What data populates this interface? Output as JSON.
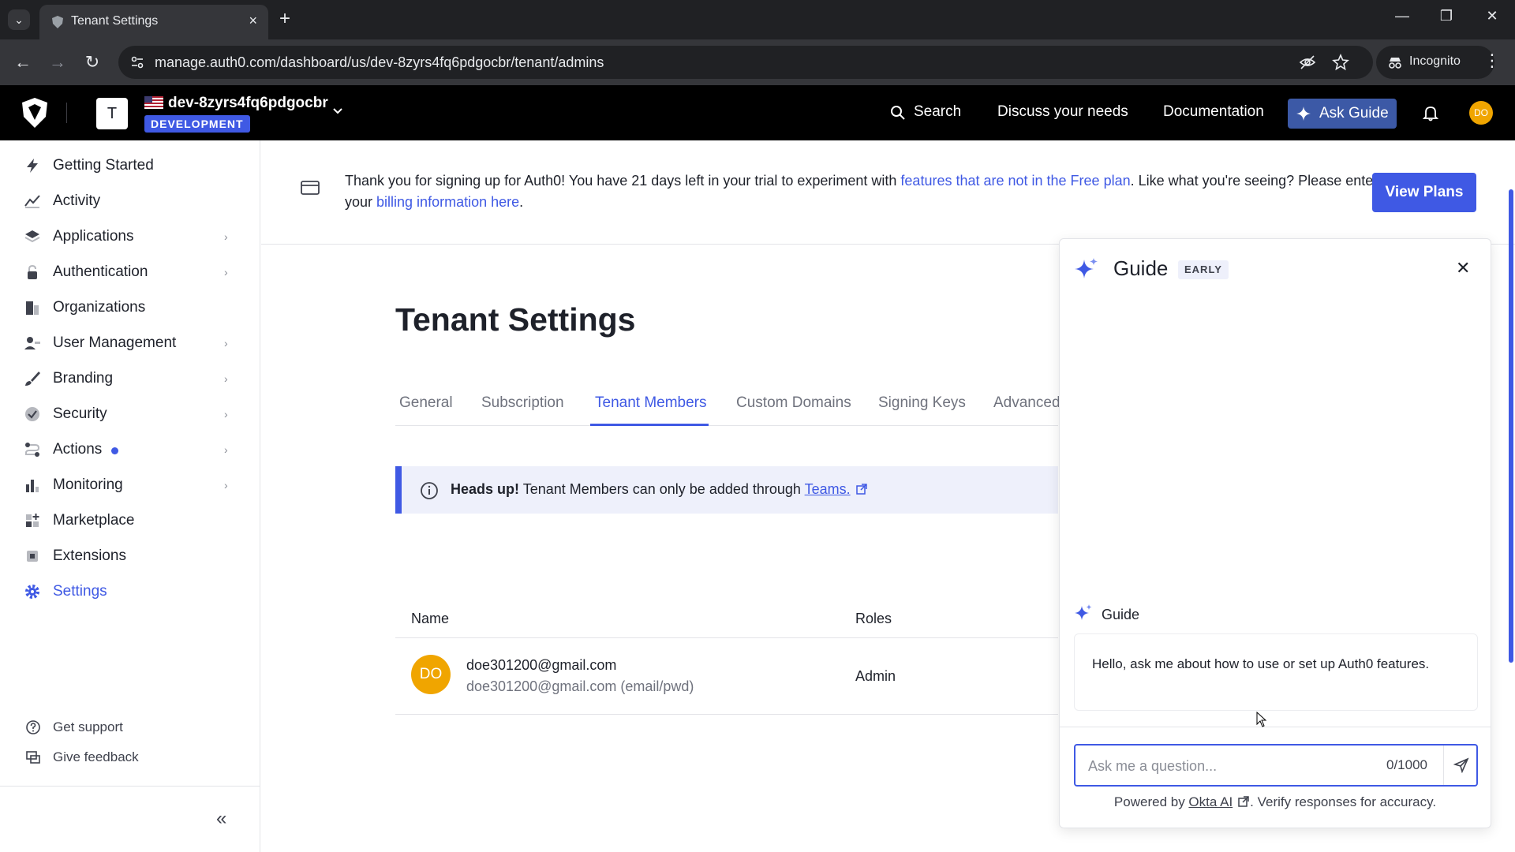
{
  "browser": {
    "tab_title": "Tenant Settings",
    "url": "manage.auth0.com/dashboard/us/dev-8zyrs4fq6pdgocbr/tenant/admins",
    "incognito_label": "Incognito"
  },
  "header": {
    "tenant_initial": "T",
    "tenant_name": "dev-8zyrs4fq6pdgocbr",
    "env_badge": "DEVELOPMENT",
    "search_label": "Search",
    "discuss_label": "Discuss your needs",
    "docs_label": "Documentation",
    "ask_guide_label": "Ask Guide",
    "user_initials": "DO"
  },
  "sidebar": {
    "items": [
      {
        "label": "Getting Started",
        "icon": "bolt-icon"
      },
      {
        "label": "Activity",
        "icon": "activity-icon"
      },
      {
        "label": "Applications",
        "icon": "layers-icon"
      },
      {
        "label": "Authentication",
        "icon": "lock-icon"
      },
      {
        "label": "Organizations",
        "icon": "building-icon"
      },
      {
        "label": "User Management",
        "icon": "users-icon"
      },
      {
        "label": "Branding",
        "icon": "brush-icon"
      },
      {
        "label": "Security",
        "icon": "shield-check-icon"
      },
      {
        "label": "Actions",
        "icon": "flow-icon"
      },
      {
        "label": "Monitoring",
        "icon": "bar-chart-icon"
      },
      {
        "label": "Marketplace",
        "icon": "grid-plus-icon"
      },
      {
        "label": "Extensions",
        "icon": "extension-icon"
      },
      {
        "label": "Settings",
        "icon": "gear-icon"
      }
    ],
    "get_support": "Get support",
    "give_feedback": "Give feedback"
  },
  "banner": {
    "text_before": "Thank you for signing up for Auth0! You have 21 days left in your trial to experiment with ",
    "link_features": "features that are not in the Free plan",
    "text_middle": ". Like what you're seeing? Please enter your ",
    "link_billing": "billing information here",
    "text_end": ".",
    "view_plans_label": "View Plans"
  },
  "main": {
    "title": "Tenant Settings",
    "tabs": [
      "General",
      "Subscription",
      "Tenant Members",
      "Custom Domains",
      "Signing Keys",
      "Advanced"
    ],
    "alert": {
      "heading": "Heads up!",
      "text": " Tenant Members can only be added through ",
      "link": "Teams."
    },
    "table": {
      "headers": [
        "Name",
        "Roles"
      ],
      "rows": [
        {
          "initials": "DO",
          "email": "doe301200@gmail.com",
          "sub": "doe301200@gmail.com (email/pwd)",
          "role": "Admin"
        }
      ]
    }
  },
  "guide": {
    "title": "Guide",
    "badge": "EARLY",
    "message_author": "Guide",
    "message_text": "Hello, ask me about how to use or set up Auth0 features.",
    "input_placeholder": "Ask me a question...",
    "char_count": "0/1000",
    "powered_prefix": "Powered by ",
    "powered_link": "Okta AI",
    "powered_suffix": ". Verify responses for accuracy."
  },
  "colors": {
    "accent": "#3f59e4",
    "ask_guide_bg": "#3c59a6",
    "avatar": "#f0a500"
  }
}
